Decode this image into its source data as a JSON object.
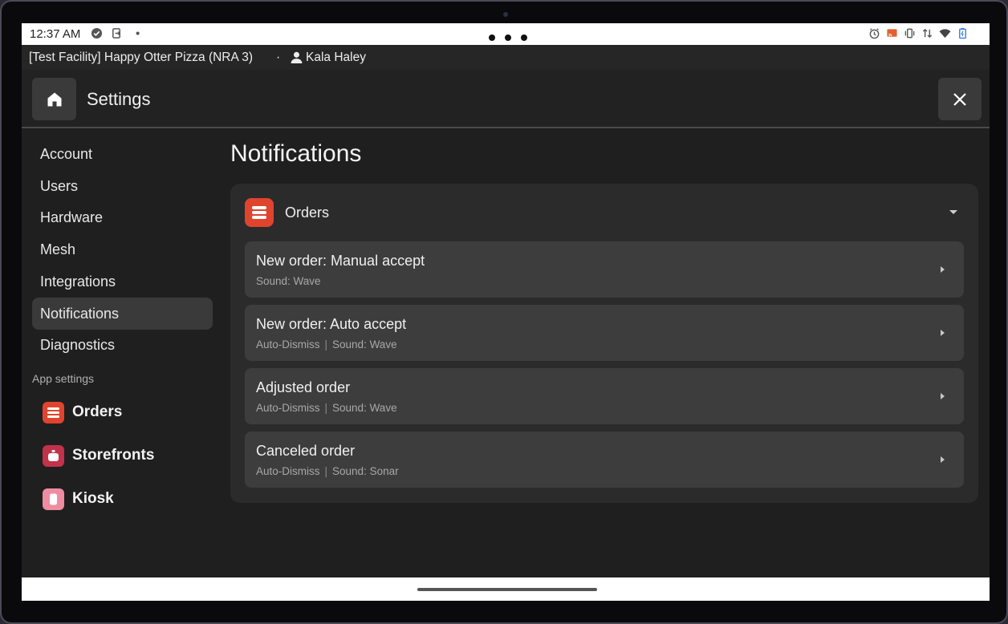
{
  "status": {
    "time": "12:37 AM"
  },
  "facility": {
    "name": "[Test Facility] Happy Otter Pizza (NRA 3)",
    "separator": "·",
    "user": "Kala Haley"
  },
  "header": {
    "title": "Settings"
  },
  "sidebar": {
    "items": [
      {
        "label": "Account"
      },
      {
        "label": "Users"
      },
      {
        "label": "Hardware"
      },
      {
        "label": "Mesh"
      },
      {
        "label": "Integrations"
      },
      {
        "label": "Notifications",
        "active": true
      },
      {
        "label": "Diagnostics"
      }
    ],
    "app_settings_label": "App settings",
    "apps": [
      {
        "label": "Orders",
        "color": "#e0442e",
        "icon": "orders-icon"
      },
      {
        "label": "Storefronts",
        "color": "#c2324a",
        "icon": "storefront-icon"
      },
      {
        "label": "Kiosk",
        "color": "#ef8ca2",
        "icon": "kiosk-icon"
      }
    ]
  },
  "main": {
    "title": "Notifications",
    "section": {
      "label": "Orders",
      "icon": "orders-icon",
      "color": "#e0442e"
    },
    "rows": [
      {
        "title": "New order: Manual accept",
        "dismiss": "",
        "sound": "Sound: Wave"
      },
      {
        "title": "New order: Auto accept",
        "dismiss": "Auto-Dismiss",
        "sound": "Sound: Wave"
      },
      {
        "title": "Adjusted order",
        "dismiss": "Auto-Dismiss",
        "sound": "Sound: Wave"
      },
      {
        "title": "Canceled order",
        "dismiss": "Auto-Dismiss",
        "sound": "Sound: Sonar"
      }
    ]
  }
}
